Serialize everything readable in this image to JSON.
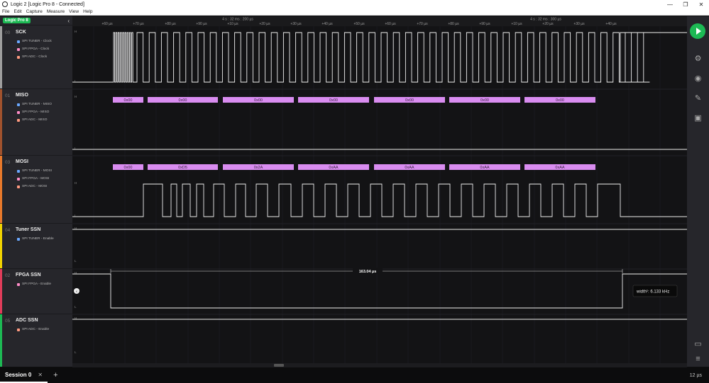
{
  "window": {
    "title": "Logic 2 [Logic Pro 8 - Connected]",
    "minimize": "—",
    "maximize": "❐",
    "close": "✕"
  },
  "menu": [
    "File",
    "Edit",
    "Capture",
    "Measure",
    "View",
    "Help"
  ],
  "device": {
    "name": "Logic Pro 8"
  },
  "ruler": {
    "group_left": "4 s : 32 ms : 200 µs",
    "group_right": "4 s : 32 ms : 300 µs",
    "ticks": [
      "+60 µs",
      "+70 µs",
      "+80 µs",
      "+90 µs",
      "+10 µs",
      "+20 µs",
      "+30 µs",
      "+40 µs",
      "+50 µs",
      "+60 µs",
      "+70 µs",
      "+80 µs",
      "+90 µs",
      "+10 µs",
      "+20 µs",
      "+30 µs",
      "+40 µs"
    ]
  },
  "channels": [
    {
      "num": "00",
      "name": "SCK",
      "color": "#9e9e9e",
      "analyzers": [
        {
          "label": "SPI TUNER - Clock",
          "color": "#6aa8ff"
        },
        {
          "label": "SPI FPGA - Clock",
          "color": "#ff8dc8"
        },
        {
          "label": "SPI ADC - Clock",
          "color": "#ff9a80"
        }
      ]
    },
    {
      "num": "01",
      "name": "MISO",
      "color": "#a0522d",
      "analyzers": [
        {
          "label": "SPI TUNER - MISO",
          "color": "#6aa8ff"
        },
        {
          "label": "SPI FPGA - MISO",
          "color": "#ff8dc8"
        },
        {
          "label": "SPI ADC - MISO",
          "color": "#ff9a80"
        }
      ]
    },
    {
      "num": "03",
      "name": "MOSI",
      "color": "#e8792b",
      "analyzers": [
        {
          "label": "SPI TUNER - MOSI",
          "color": "#6aa8ff"
        },
        {
          "label": "SPI FPGA - MOSI",
          "color": "#ff8dc8"
        },
        {
          "label": "SPI ADC - MOSI",
          "color": "#ff9a80"
        }
      ]
    },
    {
      "num": "04",
      "name": "Tuner SSN",
      "color": "#f2d400",
      "analyzers": [
        {
          "label": "SPI TUNER - Enable",
          "color": "#6aa8ff"
        }
      ]
    },
    {
      "num": "02",
      "name": "FPGA SSN",
      "color": "#e03c5a",
      "analyzers": [
        {
          "label": "SPI FPGA - Enable",
          "color": "#ff8dc8"
        }
      ]
    },
    {
      "num": "05",
      "name": "ADC SSN",
      "color": "#1db954",
      "analyzers": [
        {
          "label": "SPI ADC - Enable",
          "color": "#ff9a80"
        }
      ]
    }
  ],
  "level_labels": {
    "high": "H",
    "low": "L"
  },
  "decodes": {
    "miso": [
      "0x00",
      "0x00",
      "0x00",
      "0x00",
      "0x00",
      "0x00",
      "0x00"
    ],
    "mosi": [
      "0x00",
      "0xD5",
      "0x2A",
      "0xAA",
      "0xAA",
      "0xAA",
      "0xAA"
    ]
  },
  "measurement": {
    "duration": "163.04 µs",
    "tooltip": "width¹: 6.133 kHz"
  },
  "session": {
    "tab": "Session 0",
    "close": "✕",
    "add": "+"
  },
  "zoom": "12 µs"
}
